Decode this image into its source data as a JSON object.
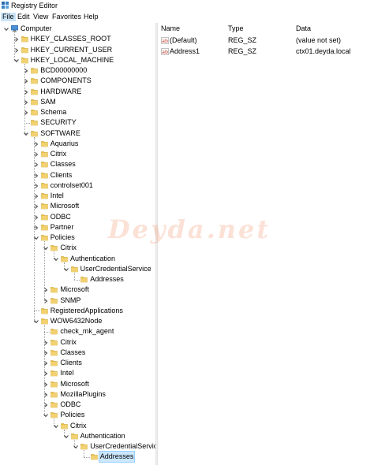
{
  "window": {
    "title": "Registry Editor"
  },
  "menu": [
    {
      "label": "File",
      "active": true
    },
    {
      "label": "Edit"
    },
    {
      "label": "View"
    },
    {
      "label": "Favorites"
    },
    {
      "label": "Help"
    }
  ],
  "tree": [
    {
      "label": "Computer",
      "depth": 0,
      "expanded": true,
      "icon": "computer-icon"
    },
    {
      "label": "HKEY_CLASSES_ROOT",
      "depth": 1,
      "expanded": false
    },
    {
      "label": "HKEY_CURRENT_USER",
      "depth": 1,
      "expanded": false
    },
    {
      "label": "HKEY_LOCAL_MACHINE",
      "depth": 1,
      "expanded": true
    },
    {
      "label": "BCD00000000",
      "depth": 2,
      "expanded": false
    },
    {
      "label": "COMPONENTS",
      "depth": 2,
      "expanded": false
    },
    {
      "label": "HARDWARE",
      "depth": 2,
      "expanded": false
    },
    {
      "label": "SAM",
      "depth": 2,
      "expanded": false
    },
    {
      "label": "Schema",
      "depth": 2,
      "expanded": false
    },
    {
      "label": "SECURITY",
      "depth": 2,
      "leaf": true
    },
    {
      "label": "SOFTWARE",
      "depth": 2,
      "expanded": true
    },
    {
      "label": "Aquarius",
      "depth": 3,
      "expanded": false
    },
    {
      "label": "Citrix",
      "depth": 3,
      "expanded": false
    },
    {
      "label": "Classes",
      "depth": 3,
      "expanded": false
    },
    {
      "label": "Clients",
      "depth": 3,
      "expanded": false
    },
    {
      "label": "controlset001",
      "depth": 3,
      "expanded": false
    },
    {
      "label": "Intel",
      "depth": 3,
      "expanded": false
    },
    {
      "label": "Microsoft",
      "depth": 3,
      "expanded": false
    },
    {
      "label": "ODBC",
      "depth": 3,
      "expanded": false
    },
    {
      "label": "Partner",
      "depth": 3,
      "expanded": false
    },
    {
      "label": "Policies",
      "depth": 3,
      "expanded": true
    },
    {
      "label": "Citrix",
      "depth": 4,
      "expanded": true
    },
    {
      "label": "Authentication",
      "depth": 5,
      "expanded": true
    },
    {
      "label": "UserCredentialService",
      "depth": 6,
      "expanded": true
    },
    {
      "label": "Addresses",
      "depth": 7,
      "leaf": true
    },
    {
      "label": "Microsoft",
      "depth": 4,
      "expanded": false
    },
    {
      "label": "SNMP",
      "depth": 4,
      "expanded": false
    },
    {
      "label": "RegisteredApplications",
      "depth": 3,
      "leaf": true
    },
    {
      "label": "WOW6432Node",
      "depth": 3,
      "expanded": true
    },
    {
      "label": "check_mk_agent",
      "depth": 4,
      "leaf": true
    },
    {
      "label": "Citrix",
      "depth": 4,
      "expanded": false
    },
    {
      "label": "Classes",
      "depth": 4,
      "expanded": false
    },
    {
      "label": "Clients",
      "depth": 4,
      "expanded": false
    },
    {
      "label": "Intel",
      "depth": 4,
      "expanded": false
    },
    {
      "label": "Microsoft",
      "depth": 4,
      "expanded": false
    },
    {
      "label": "MozillaPlugins",
      "depth": 4,
      "expanded": false
    },
    {
      "label": "ODBC",
      "depth": 4,
      "expanded": false
    },
    {
      "label": "Policies",
      "depth": 4,
      "expanded": true
    },
    {
      "label": "Citrix",
      "depth": 5,
      "expanded": true
    },
    {
      "label": "Authentication",
      "depth": 6,
      "expanded": true
    },
    {
      "label": "UserCredentialService",
      "depth": 7,
      "expanded": true
    },
    {
      "label": "Addresses",
      "depth": 8,
      "leaf": true,
      "selected": true
    }
  ],
  "list": {
    "columns": [
      "Name",
      "Type",
      "Data"
    ],
    "rows": [
      {
        "name": "(Default)",
        "type": "REG_SZ",
        "data": "(value not set)",
        "icon": "string-value-icon"
      },
      {
        "name": "Address1",
        "type": "REG_SZ",
        "data": "ctx01.deyda.local",
        "icon": "string-value-icon"
      }
    ]
  },
  "watermark": "Deyda.net",
  "colors": {
    "folder": "#e8c04a",
    "selection": "#cce8ff",
    "icon_blue": "#2b6cb0"
  }
}
